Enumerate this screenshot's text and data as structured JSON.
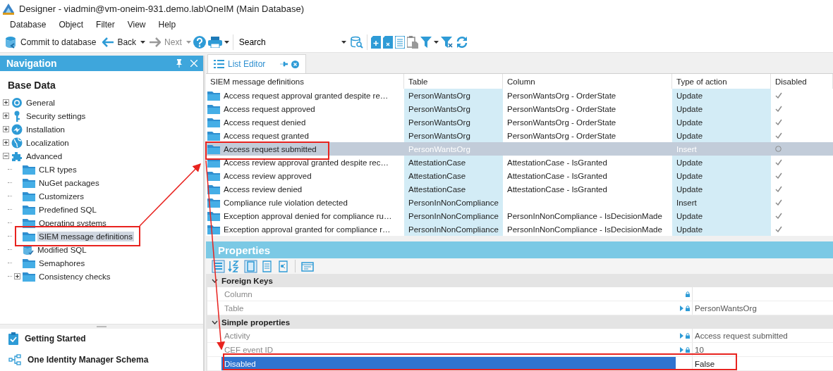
{
  "window": {
    "title": "Designer - viadmin@vm-oneim-931.demo.lab\\OneIM (Main Database)"
  },
  "menu": [
    "Database",
    "Object",
    "Filter",
    "View",
    "Help"
  ],
  "toolbar": {
    "commit": "Commit to database",
    "back": "Back",
    "next": "Next",
    "next_disabled": true,
    "search": {
      "value": "Search"
    }
  },
  "navigation": {
    "title": "Navigation",
    "section": "Base Data",
    "tree": [
      {
        "label": "General",
        "kind": "gear",
        "expanded": false,
        "selected": false
      },
      {
        "label": "Security settings",
        "kind": "key",
        "expanded": false,
        "selected": false
      },
      {
        "label": "Installation",
        "kind": "install",
        "expanded": false,
        "selected": false
      },
      {
        "label": "Localization",
        "kind": "globe",
        "expanded": false,
        "selected": false
      },
      {
        "label": "Advanced",
        "kind": "puzzle",
        "expanded": true,
        "selected": false,
        "children": [
          {
            "label": "CLR types",
            "kind": "folder",
            "selected": false
          },
          {
            "label": "NuGet packages",
            "kind": "folder",
            "selected": false
          },
          {
            "label": "Customizers",
            "kind": "folder",
            "selected": false
          },
          {
            "label": "Predefined SQL",
            "kind": "folder",
            "selected": false
          },
          {
            "label": "Operating systems",
            "kind": "folder",
            "selected": false
          },
          {
            "label": "SIEM message definitions",
            "kind": "folder",
            "selected": true
          },
          {
            "label": "Modified SQL",
            "kind": "db",
            "selected": false
          },
          {
            "label": "Semaphores",
            "kind": "folder",
            "selected": false
          },
          {
            "label": "Consistency checks",
            "kind": "folder",
            "expanded": false,
            "selected": false
          }
        ]
      }
    ],
    "bottom": [
      {
        "label": "Getting Started",
        "kind": "clipboard"
      },
      {
        "label": "One Identity Manager Schema",
        "kind": "schema"
      }
    ]
  },
  "tabs": [
    {
      "label": "List Editor",
      "selected": true
    }
  ],
  "table": {
    "columns": [
      "SIEM message definitions",
      "Table",
      "Column",
      "Type of action",
      "Disabled"
    ],
    "rows": [
      {
        "name": "Access request approval granted despite re…",
        "table": "PersonWantsOrg",
        "column": "PersonWantsOrg - OrderState",
        "action": "Update",
        "disabled": true,
        "selected": false
      },
      {
        "name": "Access request approved",
        "table": "PersonWantsOrg",
        "column": "PersonWantsOrg - OrderState",
        "action": "Update",
        "disabled": true,
        "selected": false
      },
      {
        "name": "Access request denied",
        "table": "PersonWantsOrg",
        "column": "PersonWantsOrg - OrderState",
        "action": "Update",
        "disabled": true,
        "selected": false
      },
      {
        "name": "Access request granted",
        "table": "PersonWantsOrg",
        "column": "PersonWantsOrg - OrderState",
        "action": "Update",
        "disabled": true,
        "selected": false
      },
      {
        "name": "Access request submitted",
        "table": "PersonWantsOrg",
        "action": "Insert",
        "disabled": false,
        "selected": true
      },
      {
        "name": "Access review approval granted despite rec…",
        "table": "AttestationCase",
        "column": "AttestationCase - IsGranted",
        "action": "Update",
        "disabled": true,
        "selected": false
      },
      {
        "name": "Access review approved",
        "table": "AttestationCase",
        "column": "AttestationCase - IsGranted",
        "action": "Update",
        "disabled": true,
        "selected": false
      },
      {
        "name": "Access review denied",
        "table": "AttestationCase",
        "column": "AttestationCase - IsGranted",
        "action": "Update",
        "disabled": true,
        "selected": false
      },
      {
        "name": "Compliance rule violation detected",
        "table": "PersonInNonCompliance",
        "action": "Insert",
        "disabled": true,
        "selected": false
      },
      {
        "name": "Exception approval denied for compliance ru…",
        "table": "PersonInNonCompliance",
        "column": "PersonInNonCompliance - IsDecisionMade",
        "action": "Update",
        "disabled": true,
        "selected": false
      },
      {
        "name": "Exception approval granted for compliance r…",
        "table": "PersonInNonCompliance",
        "column": "PersonInNonCompliance - IsDecisionMade",
        "action": "Update",
        "disabled": true,
        "selected": false
      }
    ]
  },
  "properties": {
    "title": "Properties",
    "categories": [
      {
        "title": "Foreign Keys",
        "expanded": true,
        "rows": [
          {
            "label": "Column",
            "linked": false,
            "selected": false
          },
          {
            "label": "Table",
            "value": "PersonWantsOrg",
            "linked": true,
            "selected": false
          }
        ]
      },
      {
        "title": "Simple properties",
        "expanded": true,
        "rows": [
          {
            "label": "Activity",
            "value": "Access request submitted",
            "linked": true,
            "selected": false
          },
          {
            "label": "CEF event ID",
            "value": "10",
            "linked": true,
            "selected": false
          },
          {
            "label": "Disabled",
            "value": "False",
            "linked": false,
            "selected": true
          }
        ]
      }
    ]
  }
}
